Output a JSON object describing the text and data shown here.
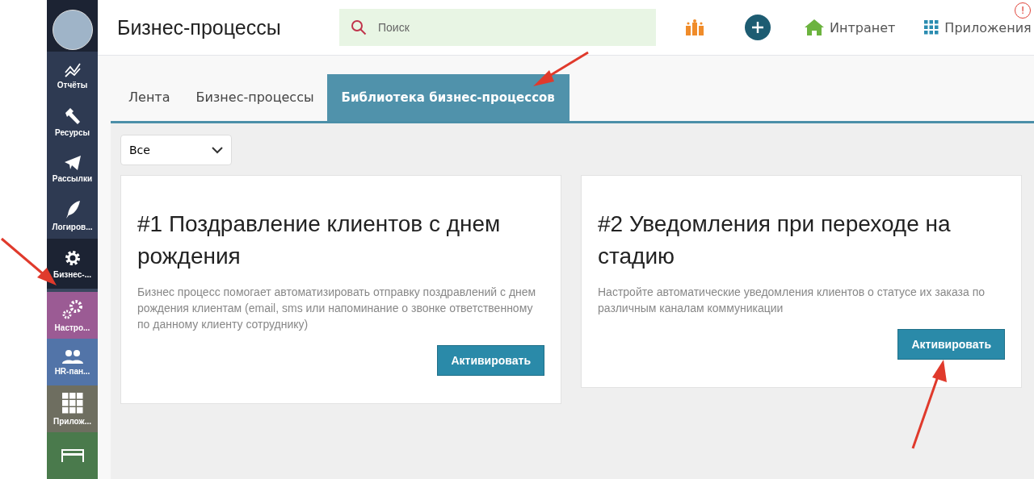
{
  "sidebar": {
    "items": [
      {
        "label": "Отчёты",
        "kind": "chart",
        "color": "#2e3a52",
        "selected": false
      },
      {
        "label": "Ресурсы",
        "kind": "hammer",
        "color": "#2e3a52",
        "selected": false
      },
      {
        "label": "Рассылки",
        "kind": "plane",
        "color": "#2e3a52",
        "selected": false
      },
      {
        "label": "Логиров...",
        "kind": "feather",
        "color": "#2e3a52",
        "selected": false
      },
      {
        "label": "Бизнес-...",
        "kind": "gear",
        "color": "#1c2333",
        "selected": true
      },
      {
        "label": "Настро...",
        "kind": "gears",
        "color": "#9b5b94",
        "selected": false
      },
      {
        "label": "HR-пан...",
        "kind": "people",
        "color": "#5274a8",
        "selected": false
      },
      {
        "label": "Прилож...",
        "kind": "grid",
        "color": "#6e6e60",
        "selected": false
      },
      {
        "kind": "card",
        "color": "#4a7a4c",
        "selected": false
      }
    ]
  },
  "header": {
    "title": "Бизнес-процессы",
    "search": {
      "placeholder": "Поиск"
    },
    "links": [
      {
        "label": "Интранет",
        "kind": "home"
      },
      {
        "label": "Приложения",
        "kind": "grid"
      }
    ],
    "alert": "!"
  },
  "tabs": [
    {
      "label": "Лента",
      "selected": false
    },
    {
      "label": "Бизнес-процессы",
      "selected": false
    },
    {
      "label": "Библиотека бизнес-процессов",
      "selected": true
    }
  ],
  "filter": {
    "value": "Все"
  },
  "cards": [
    {
      "title": "#1 Поздравление клиентов с днем рождения",
      "description": "Бизнес процесс помогает автоматизировать отправку поздравлений с днем рождения клиентам (email, sms или напоминание о звонке ответственному по данному клиенту сотруднику)",
      "button": "Активировать"
    },
    {
      "title": "#2 Уведомления при переходе на стадию",
      "description": "Настройте автоматические уведомления клиентов о статусе их заказа по различным каналам коммуникации",
      "button": "Активировать"
    }
  ]
}
